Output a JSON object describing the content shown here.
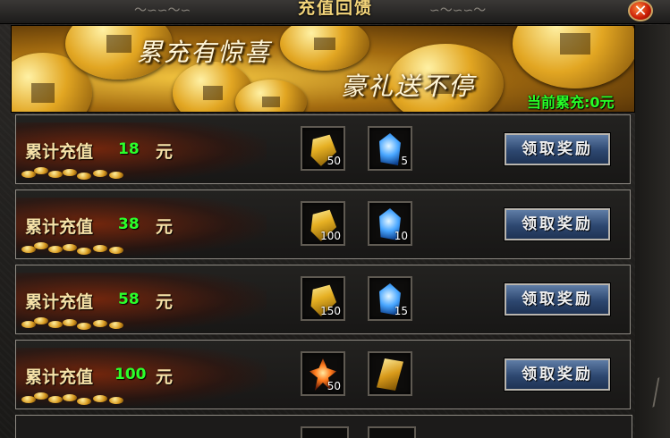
{
  "window": {
    "title": "充值回馈",
    "close_icon": "close-icon"
  },
  "banner": {
    "slogan_1": "累充有惊喜",
    "slogan_2": "豪礼送不停",
    "current_label": "当前累充:",
    "current_value": "0元"
  },
  "colors": {
    "value_green": "#2bff2b",
    "label_gold": "#f6e2a8",
    "button_blue": "#2d4770"
  },
  "rows": [
    {
      "label": "累计充值",
      "amount": "18",
      "unit": "元",
      "rewards": [
        {
          "icon": "gold-crystal-icon",
          "count": "50"
        },
        {
          "icon": "blue-gem-icon",
          "count": "5"
        }
      ],
      "button": "领取奖励"
    },
    {
      "label": "累计充值",
      "amount": "38",
      "unit": "元",
      "rewards": [
        {
          "icon": "gold-crystal-icon",
          "count": "100"
        },
        {
          "icon": "blue-gem-icon",
          "count": "10"
        }
      ],
      "button": "领取奖励"
    },
    {
      "label": "累计充值",
      "amount": "58",
      "unit": "元",
      "rewards": [
        {
          "icon": "gold-crystal-icon",
          "count": "150"
        },
        {
          "icon": "blue-gem-icon",
          "count": "15"
        }
      ],
      "button": "领取奖励"
    },
    {
      "label": "累计充值",
      "amount": "100",
      "unit": "元",
      "rewards": [
        {
          "icon": "fire-crystal-icon",
          "count": "50"
        },
        {
          "icon": "gold-scroll-icon",
          "count": ""
        }
      ],
      "button": "领取奖励"
    }
  ]
}
